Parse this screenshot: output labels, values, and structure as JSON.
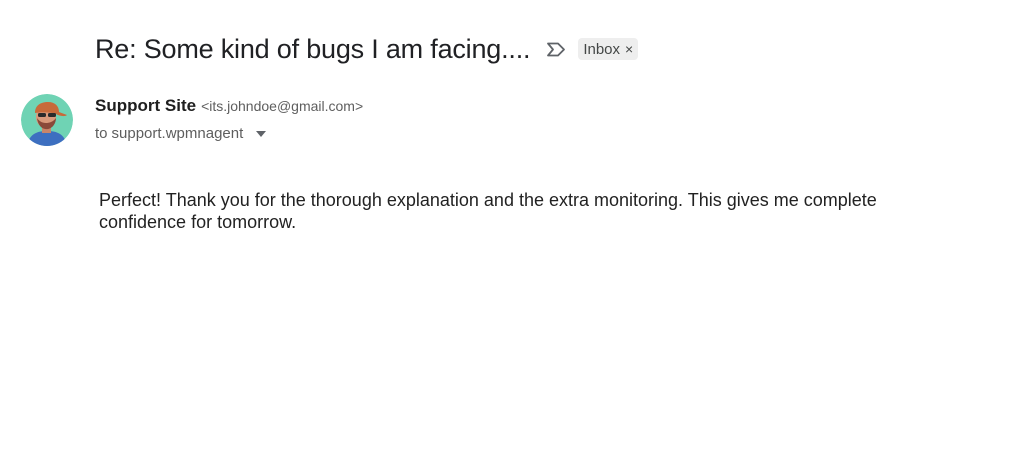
{
  "email": {
    "subject": "Re: Some kind of bugs I am facing....",
    "important_icon": "important-marker-icon",
    "label": {
      "name": "Inbox",
      "remove_symbol": "×"
    },
    "sender": {
      "name": "Support Site",
      "email": "<its.johndoe@gmail.com>",
      "avatar_icon": "user-avatar",
      "avatar_bg": "#6fd3b4"
    },
    "recipient": {
      "prefix": "to",
      "name": "support.wpmnagent",
      "dropdown_icon": "chevron-down-icon"
    },
    "body": "Perfect! Thank you for the thorough explanation and the extra monitoring. This gives me complete confidence for tomorrow."
  }
}
